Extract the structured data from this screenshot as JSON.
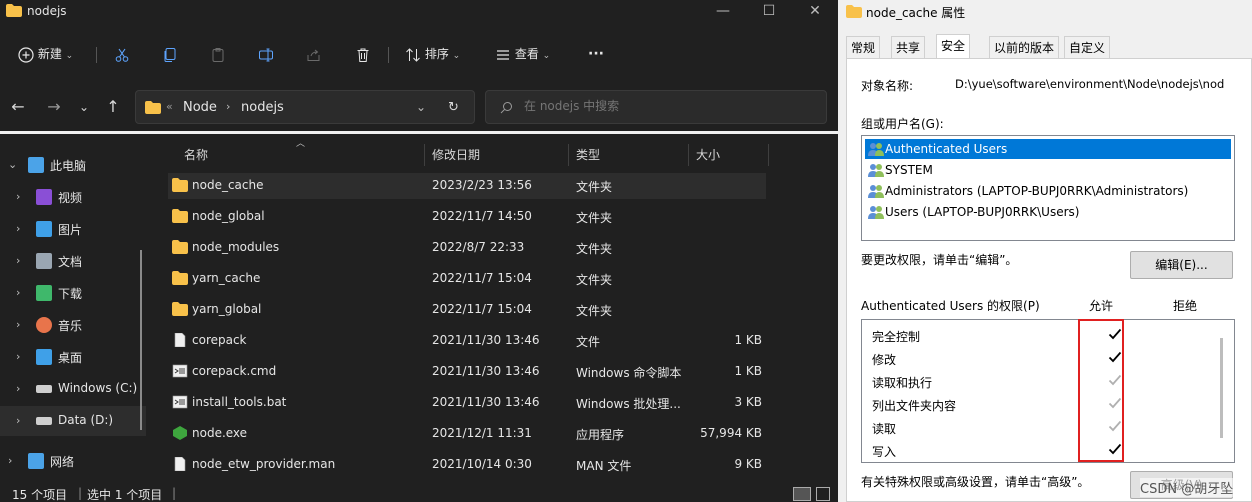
{
  "explorer": {
    "window_title": "nodejs",
    "toolbar": {
      "new_label": "新建",
      "sort_label": "排序",
      "view_label": "查看",
      "more_label": "···"
    },
    "address": {
      "crumb_sep": "«",
      "crumb1": "Node",
      "crumb2": "nodejs",
      "search_placeholder": "在 nodejs 中搜索"
    },
    "sidebar": [
      {
        "label": "此电脑",
        "icon": "pc-icon",
        "expanded": true
      },
      {
        "label": "视频",
        "icon": "video-icon"
      },
      {
        "label": "图片",
        "icon": "picture-icon"
      },
      {
        "label": "文档",
        "icon": "document-icon"
      },
      {
        "label": "下载",
        "icon": "download-icon"
      },
      {
        "label": "音乐",
        "icon": "music-icon"
      },
      {
        "label": "桌面",
        "icon": "desktop-icon"
      },
      {
        "label": "Windows (C:)",
        "icon": "drive-icon"
      },
      {
        "label": "Data (D:)",
        "icon": "drive-icon",
        "selected": true
      },
      {
        "label": "网络",
        "icon": "network-icon"
      }
    ],
    "columns": {
      "name": "名称",
      "modified": "修改日期",
      "type": "类型",
      "size": "大小"
    },
    "files": [
      {
        "name": "node_cache",
        "modified": "2023/2/23 13:56",
        "type": "文件夹",
        "size": "",
        "kind": "folder",
        "selected": true
      },
      {
        "name": "node_global",
        "modified": "2022/11/7 14:50",
        "type": "文件夹",
        "size": "",
        "kind": "folder"
      },
      {
        "name": "node_modules",
        "modified": "2022/8/7 22:33",
        "type": "文件夹",
        "size": "",
        "kind": "folder"
      },
      {
        "name": "yarn_cache",
        "modified": "2022/11/7 15:04",
        "type": "文件夹",
        "size": "",
        "kind": "folder"
      },
      {
        "name": "yarn_global",
        "modified": "2022/11/7 15:04",
        "type": "文件夹",
        "size": "",
        "kind": "folder"
      },
      {
        "name": "corepack",
        "modified": "2021/11/30 13:46",
        "type": "文件",
        "size": "1 KB",
        "kind": "file"
      },
      {
        "name": "corepack.cmd",
        "modified": "2021/11/30 13:46",
        "type": "Windows 命令脚本",
        "size": "1 KB",
        "kind": "cmd"
      },
      {
        "name": "install_tools.bat",
        "modified": "2021/11/30 13:46",
        "type": "Windows 批处理...",
        "size": "3 KB",
        "kind": "cmd"
      },
      {
        "name": "node.exe",
        "modified": "2021/12/1 11:31",
        "type": "应用程序",
        "size": "57,994 KB",
        "kind": "exe"
      },
      {
        "name": "node_etw_provider.man",
        "modified": "2021/10/14 0:30",
        "type": "MAN 文件",
        "size": "9 KB",
        "kind": "file"
      }
    ],
    "status": {
      "count": "15 个项目",
      "selected": "选中 1 个项目"
    }
  },
  "props": {
    "title": "node_cache 属性",
    "tabs": [
      "常规",
      "共享",
      "安全",
      "以前的版本",
      "自定义"
    ],
    "active_tab": "安全",
    "object_label": "对象名称:",
    "object_value": "D:\\yue\\software\\environment\\Node\\nodejs\\nod",
    "group_label": "组或用户名(G):",
    "users": [
      {
        "label": "Authenticated Users",
        "selected": true
      },
      {
        "label": "SYSTEM"
      },
      {
        "label": "Administrators (LAPTOP-BUPJ0RRK\\Administrators)"
      },
      {
        "label": "Users (LAPTOP-BUPJ0RRK\\Users)"
      }
    ],
    "change_hint": "要更改权限，请单击“编辑”。",
    "edit_button": "编辑(E)...",
    "perm_header": "Authenticated Users 的权限(P)",
    "allow_header": "允许",
    "deny_header": "拒绝",
    "permissions": [
      {
        "name": "完全控制",
        "allow": "explicit"
      },
      {
        "name": "修改",
        "allow": "explicit"
      },
      {
        "name": "读取和执行",
        "allow": "inherited"
      },
      {
        "name": "列出文件夹内容",
        "allow": "inherited"
      },
      {
        "name": "读取",
        "allow": "inherited"
      },
      {
        "name": "写入",
        "allow": "explicit"
      }
    ],
    "advanced_hint": "有关特殊权限或高级设置，请单击“高级”。",
    "advanced_button": "高级(V)",
    "watermark": "CSDN @胡牙坠",
    "accent": "#0078d7",
    "highlight": "#e02020"
  }
}
